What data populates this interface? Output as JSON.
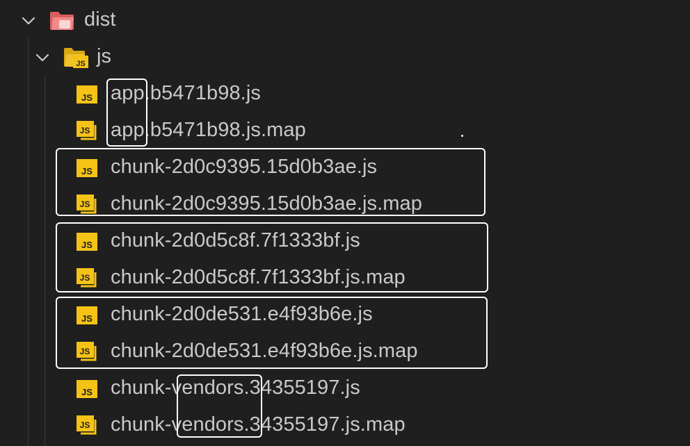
{
  "explorer": {
    "root_folder": {
      "name": "dist",
      "expanded": true
    },
    "sub_folder": {
      "name": "js",
      "expanded": true
    },
    "files": [
      {
        "name": "app.b5471b98.js",
        "type": "js"
      },
      {
        "name": "app.b5471b98.js.map",
        "type": "map"
      },
      {
        "name": "chunk-2d0c9395.15d0b3ae.js",
        "type": "js"
      },
      {
        "name": "chunk-2d0c9395.15d0b3ae.js.map",
        "type": "map"
      },
      {
        "name": "chunk-2d0d5c8f.7f1333bf.js",
        "type": "js"
      },
      {
        "name": "chunk-2d0d5c8f.7f1333bf.js.map",
        "type": "map"
      },
      {
        "name": "chunk-2d0de531.e4f93b6e.js",
        "type": "js"
      },
      {
        "name": "chunk-2d0de531.e4f93b6e.js.map",
        "type": "map"
      },
      {
        "name": "chunk-vendors.34355197.js",
        "type": "js"
      },
      {
        "name": "chunk-vendors.34355197.js.map",
        "type": "map"
      }
    ]
  },
  "icons": {
    "js_file_icon_text": "JS",
    "js_folder_icon_text": "JS"
  },
  "colors": {
    "background": "#1f1f20",
    "text": "#c9c9c9",
    "js_yellow": "#f5c316",
    "dist_folder": "#e26d6d",
    "highlight_border": "#ffffff"
  }
}
